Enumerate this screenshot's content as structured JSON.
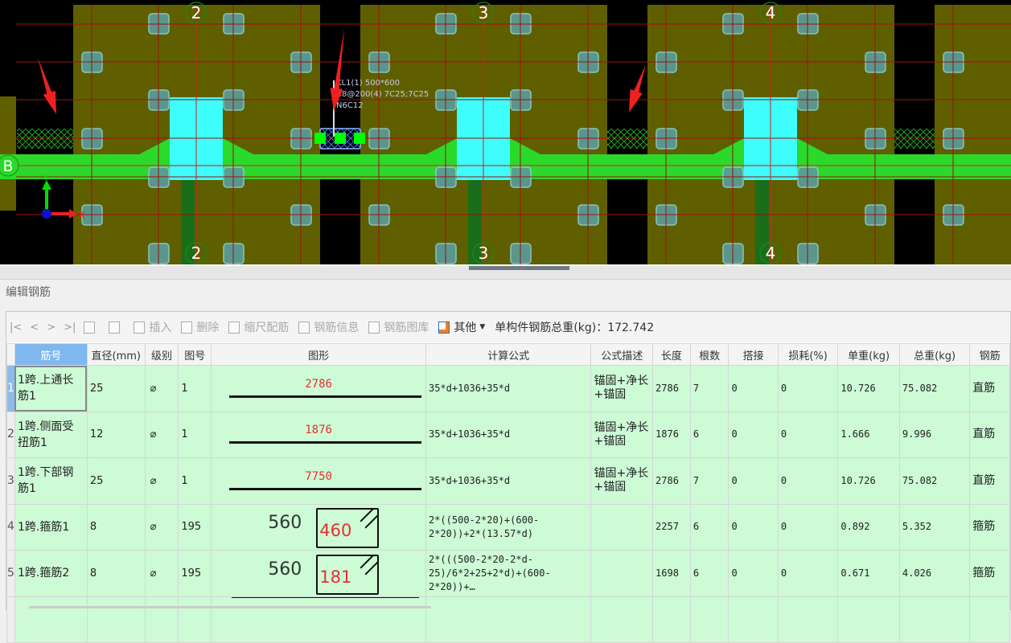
{
  "cad": {
    "axis_labels": [
      "2",
      "3",
      "4"
    ],
    "row_axis_label": "B",
    "annotation": [
      "KL1(1) 500*600",
      "C8@200(4) 7C25;7C25",
      "N6C12"
    ],
    "ucs": {
      "x": "X",
      "y": "Y"
    },
    "colors": {
      "slab": "#5f5f00",
      "beam": "#2ad92a",
      "column": "#3dfdfd",
      "pile": "#5a9c9c",
      "grid": "#a01010",
      "arrow": "#f02020"
    }
  },
  "panel": {
    "title": "编辑钢筋"
  },
  "toolbar": {
    "nav": [
      "|<",
      "<",
      ">",
      ">|"
    ],
    "insert": "插入",
    "delete": "删除",
    "scale": "缩尺配筋",
    "info": "钢筋信息",
    "library": "钢筋图库",
    "other": "其他",
    "total_label": "单构件钢筋总重(kg)：172.742"
  },
  "table": {
    "headers": [
      "筋号",
      "直径(mm)",
      "级别",
      "图号",
      "图形",
      "计算公式",
      "公式描述",
      "长度",
      "根数",
      "搭接",
      "损耗(%)",
      "单重(kg)",
      "总重(kg)",
      "钢筋"
    ],
    "rows": [
      {
        "n": "1",
        "name": "1跨.上通长筋1",
        "dia": "25",
        "grade": "⌀",
        "fig": "1",
        "shape": {
          "type": "line",
          "value": "2786"
        },
        "formula": "35*d+1036+35*d",
        "desc": "锚固+净长+锚固",
        "len": "2786",
        "count": "7",
        "lap": "0",
        "loss": "0",
        "unit": "10.726",
        "total": "75.082",
        "kind": "直筋"
      },
      {
        "n": "2",
        "name": "1跨.侧面受扭筋1",
        "dia": "12",
        "grade": "⌀",
        "fig": "1",
        "shape": {
          "type": "line",
          "value": "1876"
        },
        "formula": "35*d+1036+35*d",
        "desc": "锚固+净长+锚固",
        "len": "1876",
        "count": "6",
        "lap": "0",
        "loss": "0",
        "unit": "1.666",
        "total": "9.996",
        "kind": "直筋"
      },
      {
        "n": "3",
        "name": "1跨.下部钢筋1",
        "dia": "25",
        "grade": "⌀",
        "fig": "1",
        "shape": {
          "type": "line",
          "value": "7750"
        },
        "formula": "35*d+1036+35*d",
        "desc": "锚固+净长+锚固",
        "len": "2786",
        "count": "7",
        "lap": "0",
        "loss": "0",
        "unit": "10.726",
        "total": "75.082",
        "kind": "直筋"
      },
      {
        "n": "4",
        "name": "1跨.箍筋1",
        "dia": "8",
        "grade": "⌀",
        "fig": "195",
        "shape": {
          "type": "stirrup",
          "a": "560",
          "b": "460"
        },
        "formula": "2*((500-2*20)+(600-2*20))+2*(13.57*d)",
        "desc": "",
        "len": "2257",
        "count": "6",
        "lap": "0",
        "loss": "0",
        "unit": "0.892",
        "total": "5.352",
        "kind": "箍筋"
      },
      {
        "n": "5",
        "name": "1跨.箍筋2",
        "dia": "8",
        "grade": "⌀",
        "fig": "195",
        "shape": {
          "type": "stirrup",
          "a": "560",
          "b": "181"
        },
        "formula": "2*(((500-2*20-2*d-25)/6*2+25+2*d)+(600-2*20))+…",
        "desc": "",
        "len": "1698",
        "count": "6",
        "lap": "0",
        "loss": "0",
        "unit": "0.671",
        "total": "4.026",
        "kind": "箍筋"
      }
    ]
  }
}
